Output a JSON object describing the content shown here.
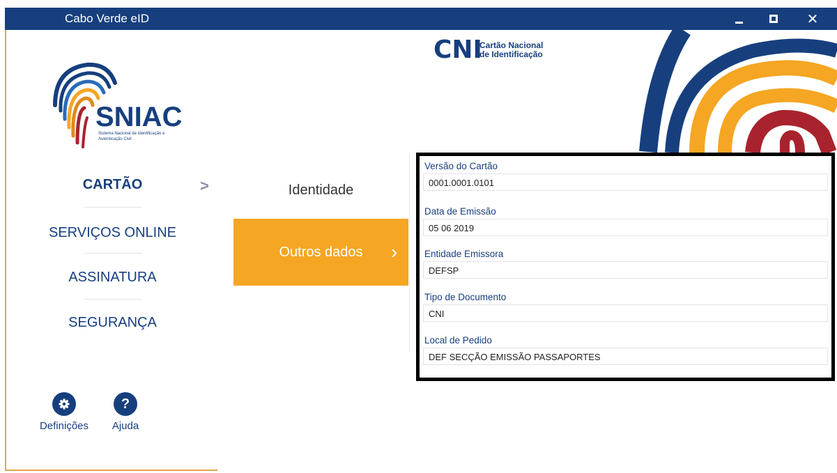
{
  "window": {
    "title": "Cabo Verde eID"
  },
  "sidebar": {
    "logo": {
      "name": "SNIAC",
      "subtitle_line1": "Sistema Nacional de Identificação e",
      "subtitle_line2": "Autenticação Civil"
    },
    "items": [
      {
        "label": "CARTÃO",
        "active": true
      },
      {
        "label": "SERVIÇOS ONLINE"
      },
      {
        "label": "ASSINATURA"
      },
      {
        "label": "SEGURANÇA"
      }
    ],
    "footer": {
      "settings_label": "Definições",
      "help_label": "Ajuda"
    }
  },
  "submenu": {
    "items": [
      {
        "label": "Identidade"
      },
      {
        "label": "Outros dados",
        "active": true
      }
    ]
  },
  "brand": {
    "cni": "CNI",
    "cni_line1": "Cartão Nacional",
    "cni_line2": "de Identificação"
  },
  "fields": [
    {
      "label": "Versão do Cartão",
      "value": "0001.0001.0101"
    },
    {
      "label": "Data de Emissão",
      "value": "05 06 2019"
    },
    {
      "label": "Entidade Emissora",
      "value": "DEFSP"
    },
    {
      "label": "Tipo de Documento",
      "value": "CNI"
    },
    {
      "label": "Local de Pedido",
      "value": "DEF SECÇÃO EMISSÃO PASSAPORTES"
    }
  ],
  "colors": {
    "primary": "#173f7e",
    "accent": "#f5a623",
    "deco_red": "#a8232d"
  },
  "icons": {
    "settings": "gear-icon",
    "help": "question-icon",
    "nav": "chevron-right-icon"
  }
}
